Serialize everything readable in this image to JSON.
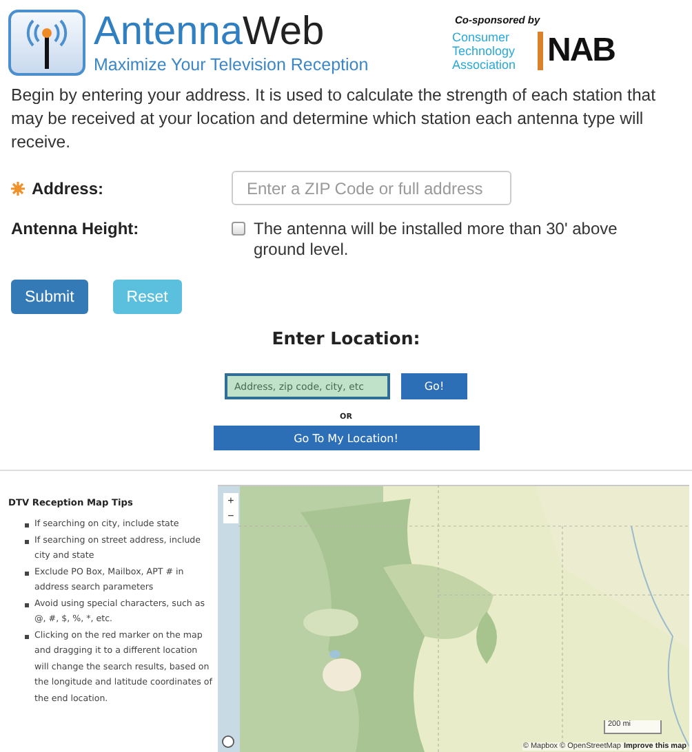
{
  "header": {
    "title_start": "Antenna",
    "title_end": "Web",
    "tagline": "Maximize Your Television Reception",
    "sponsor_label": "Co-sponsored by",
    "sponsor_1": "Consumer Technology Association",
    "sponsor_2": "NAB"
  },
  "intro": "Begin by entering your address. It is used to calculate the strength of each station that may be received at your location and determine which station each antenna type will receive.",
  "address": {
    "label": "Address:",
    "placeholder": "Enter a ZIP Code or full address"
  },
  "antenna_height": {
    "label": "Antenna Height:",
    "option": "The antenna will be installed more than 30' above ground level.",
    "checked": false
  },
  "buttons": [
    "Submit",
    "Reset"
  ],
  "location": {
    "title": "Enter Location:",
    "placeholder": "Address, zip code, city, etc",
    "go": "Go!",
    "or": "OR",
    "my_location": "Go To My Location!"
  },
  "tips": {
    "title": "DTV Reception Map Tips",
    "items": [
      "If searching on city, include state",
      "If searching on street address, include city and state",
      "Exclude PO Box, Mailbox, APT # in address search parameters",
      "Avoid using special characters, such as @, #, $, %, *, etc.",
      "Clicking on the red marker on the map and dragging it to a different location will change the search results, based on the longitude and latitude coordinates of the end location."
    ]
  },
  "map": {
    "kind": "picture",
    "zoom_in": "+",
    "zoom_out": "−",
    "scale": "200 mi",
    "attribution": "© Mapbox © OpenStreetMap",
    "improve": "Improve this map"
  }
}
